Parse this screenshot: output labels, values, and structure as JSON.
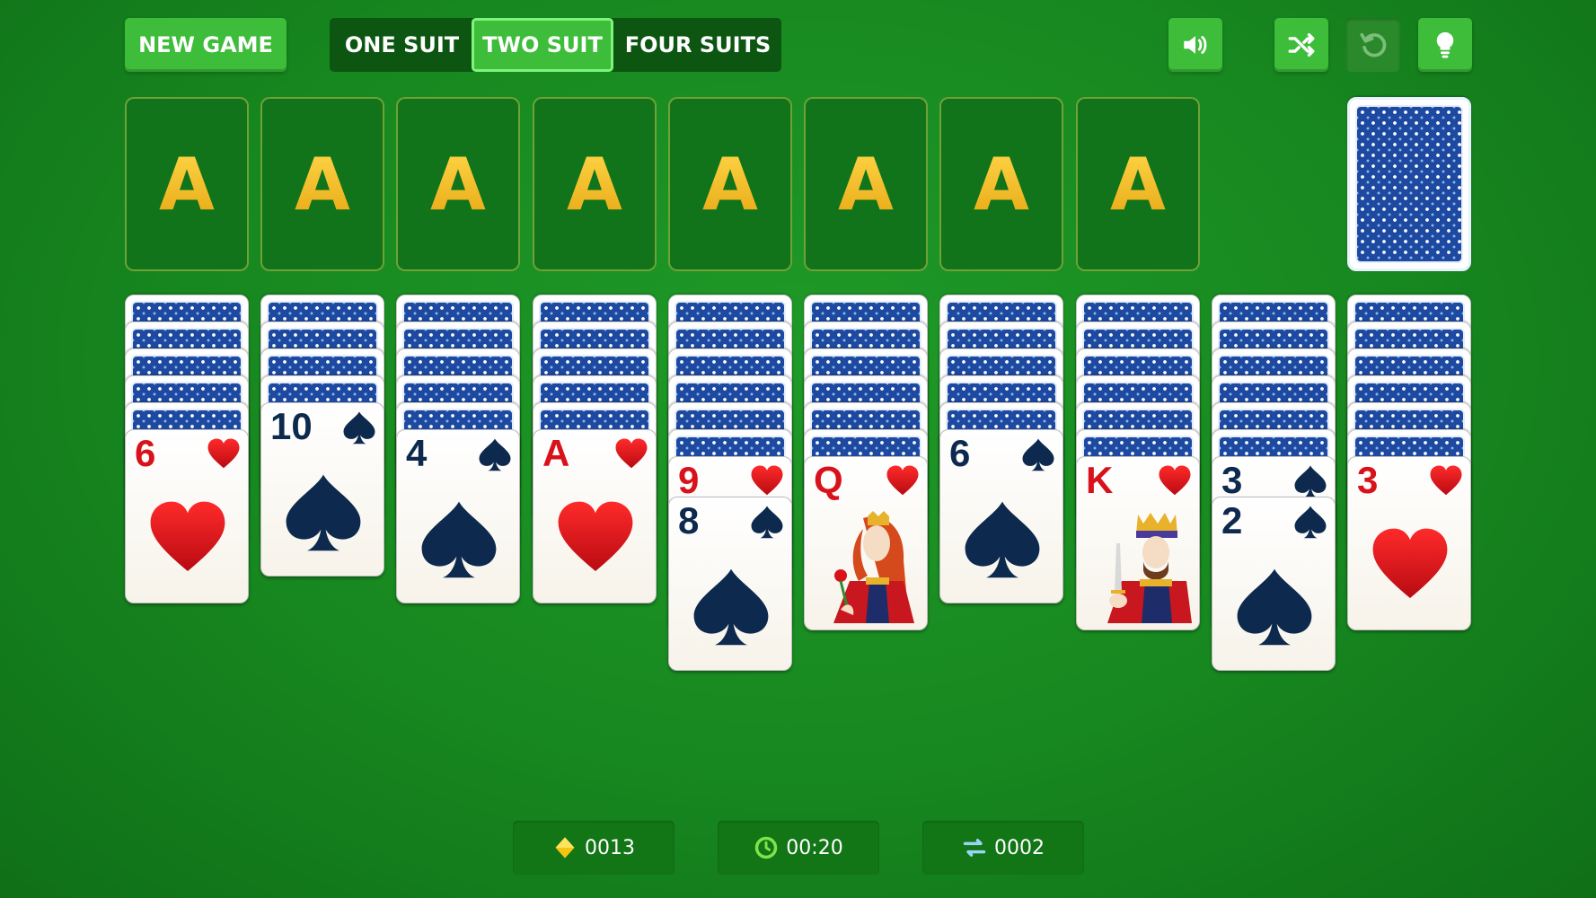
{
  "toolbar": {
    "new_game_label": "NEW GAME",
    "suit_options": [
      "ONE SUIT",
      "TWO SUIT",
      "FOUR SUITS"
    ],
    "selected_suit_option": "TWO SUIT",
    "icons": [
      "volume-icon",
      "shuffle-icon",
      "undo-icon",
      "hint-lightbulb-icon"
    ]
  },
  "foundation": {
    "slots": [
      "A",
      "A",
      "A",
      "A",
      "A",
      "A",
      "A",
      "A"
    ],
    "stock": "card-back"
  },
  "tableau": [
    {
      "hidden": 5,
      "cards": [
        {
          "rank": "6",
          "suit": "hearts"
        }
      ]
    },
    {
      "hidden": 4,
      "cards": [
        {
          "rank": "10",
          "suit": "spades"
        }
      ]
    },
    {
      "hidden": 5,
      "cards": [
        {
          "rank": "4",
          "suit": "spades"
        }
      ]
    },
    {
      "hidden": 5,
      "cards": [
        {
          "rank": "A",
          "suit": "hearts"
        }
      ]
    },
    {
      "hidden": 6,
      "cards": [
        {
          "rank": "9",
          "suit": "hearts"
        },
        {
          "rank": "8",
          "suit": "spades"
        }
      ]
    },
    {
      "hidden": 6,
      "cards": [
        {
          "rank": "Q",
          "suit": "hearts"
        }
      ]
    },
    {
      "hidden": 5,
      "cards": [
        {
          "rank": "6",
          "suit": "spades"
        }
      ]
    },
    {
      "hidden": 6,
      "cards": [
        {
          "rank": "K",
          "suit": "hearts"
        }
      ]
    },
    {
      "hidden": 6,
      "cards": [
        {
          "rank": "3",
          "suit": "spades"
        },
        {
          "rank": "2",
          "suit": "spades"
        }
      ]
    },
    {
      "hidden": 6,
      "cards": [
        {
          "rank": "3",
          "suit": "hearts"
        }
      ]
    }
  ],
  "status": {
    "score": "0013",
    "time": "00:20",
    "moves": "0002"
  },
  "colors": {
    "felt": "#17871f",
    "button_green": "#3dbd3a",
    "heart_red": "#d8121b",
    "spade_navy": "#0d2a4e",
    "card_back_blue": "#1d4aa0",
    "ace_gold": "#f2c22a"
  }
}
